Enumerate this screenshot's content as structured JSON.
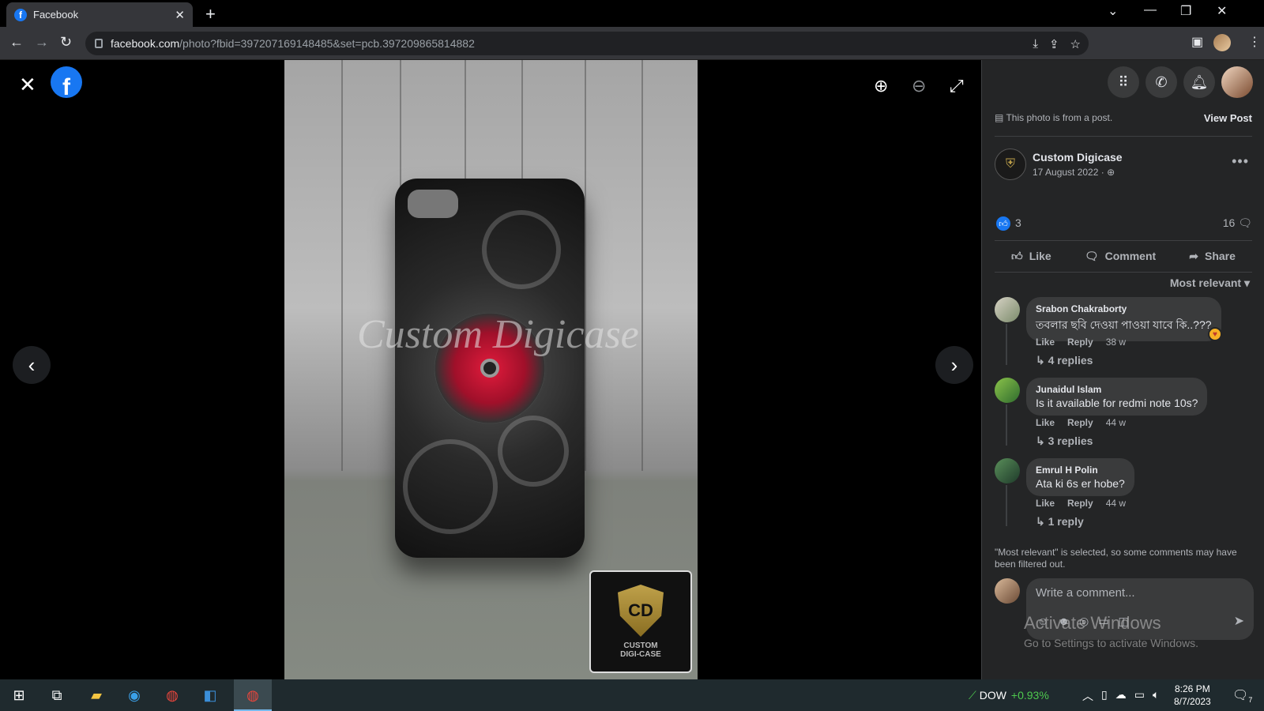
{
  "browser": {
    "tab_title": "Facebook",
    "url_host": "facebook.com",
    "url_path": "/photo?fbid=397207169148485&set=pcb.397209865814882",
    "favicon_letter": "f"
  },
  "viewer": {
    "watermark_text": "Custom Digicase",
    "brand_monogram": "CD",
    "brand_line1": "CUSTOM",
    "brand_line2": "DIGI-CASE",
    "prev_label": "‹",
    "next_label": "›"
  },
  "sidebar": {
    "post_note": "This photo is from a post.",
    "view_post": "View Post",
    "author": "Custom Digicase",
    "date": "17 August 2022 · ",
    "like_count": "3",
    "comment_count": "16",
    "actions": {
      "like": "Like",
      "comment": "Comment",
      "share": "Share"
    },
    "sort_label": "Most relevant",
    "comments": [
      {
        "name": "Srabon Chakraborty",
        "text": "তবলার ছবি দেওয়া পাওয়া যাবে কি..???",
        "like": "Like",
        "reply": "Reply",
        "time": "38 w",
        "replies": "4 replies"
      },
      {
        "name": "Junaidul Islam",
        "text": "Is it available for redmi note 10s?",
        "like": "Like",
        "reply": "Reply",
        "time": "44 w",
        "replies": "3 replies"
      },
      {
        "name": "Emrul H Polin",
        "text": "Ata ki 6s er hobe?",
        "like": "Like",
        "reply": "Reply",
        "time": "44 w",
        "replies": "1 reply"
      }
    ],
    "filter_note": "\"Most relevant\" is selected, so some comments may have been filtered out.",
    "write_placeholder": "Write a comment..."
  },
  "os": {
    "activate_title": "Activate Windows",
    "activate_sub": "Go to Settings to activate Windows.",
    "ticker": "DOW",
    "ticker_change": "+0.93%",
    "time": "8:26 PM",
    "date": "8/7/2023",
    "notif_count": "7"
  },
  "colors": {
    "accent": "#1877f2",
    "panel": "#242526",
    "bubble": "#3a3b3c",
    "ticker_up": "#4ec94e"
  }
}
